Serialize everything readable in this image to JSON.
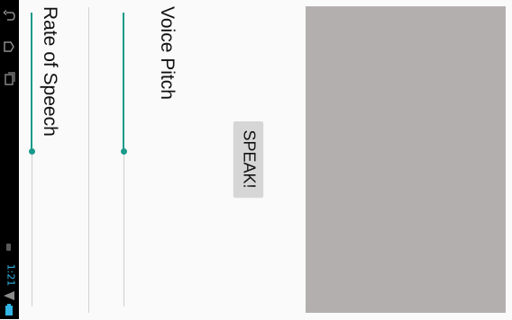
{
  "status_bar": {
    "time": "1:21",
    "accent_color": "#33b5e5",
    "icons": [
      "back-icon",
      "home-icon",
      "recent-apps-icon",
      "wifi-icon",
      "battery-icon"
    ]
  },
  "controls": {
    "rate_label": "Rate of Speech",
    "pitch_label": "Voice Pitch",
    "speak_label": "SPEAK!",
    "rate_progress": 0.47,
    "pitch_progress": 0.47,
    "accent_color": "#1a9a8b"
  },
  "image_panel": {
    "color": "#b4afaf"
  }
}
